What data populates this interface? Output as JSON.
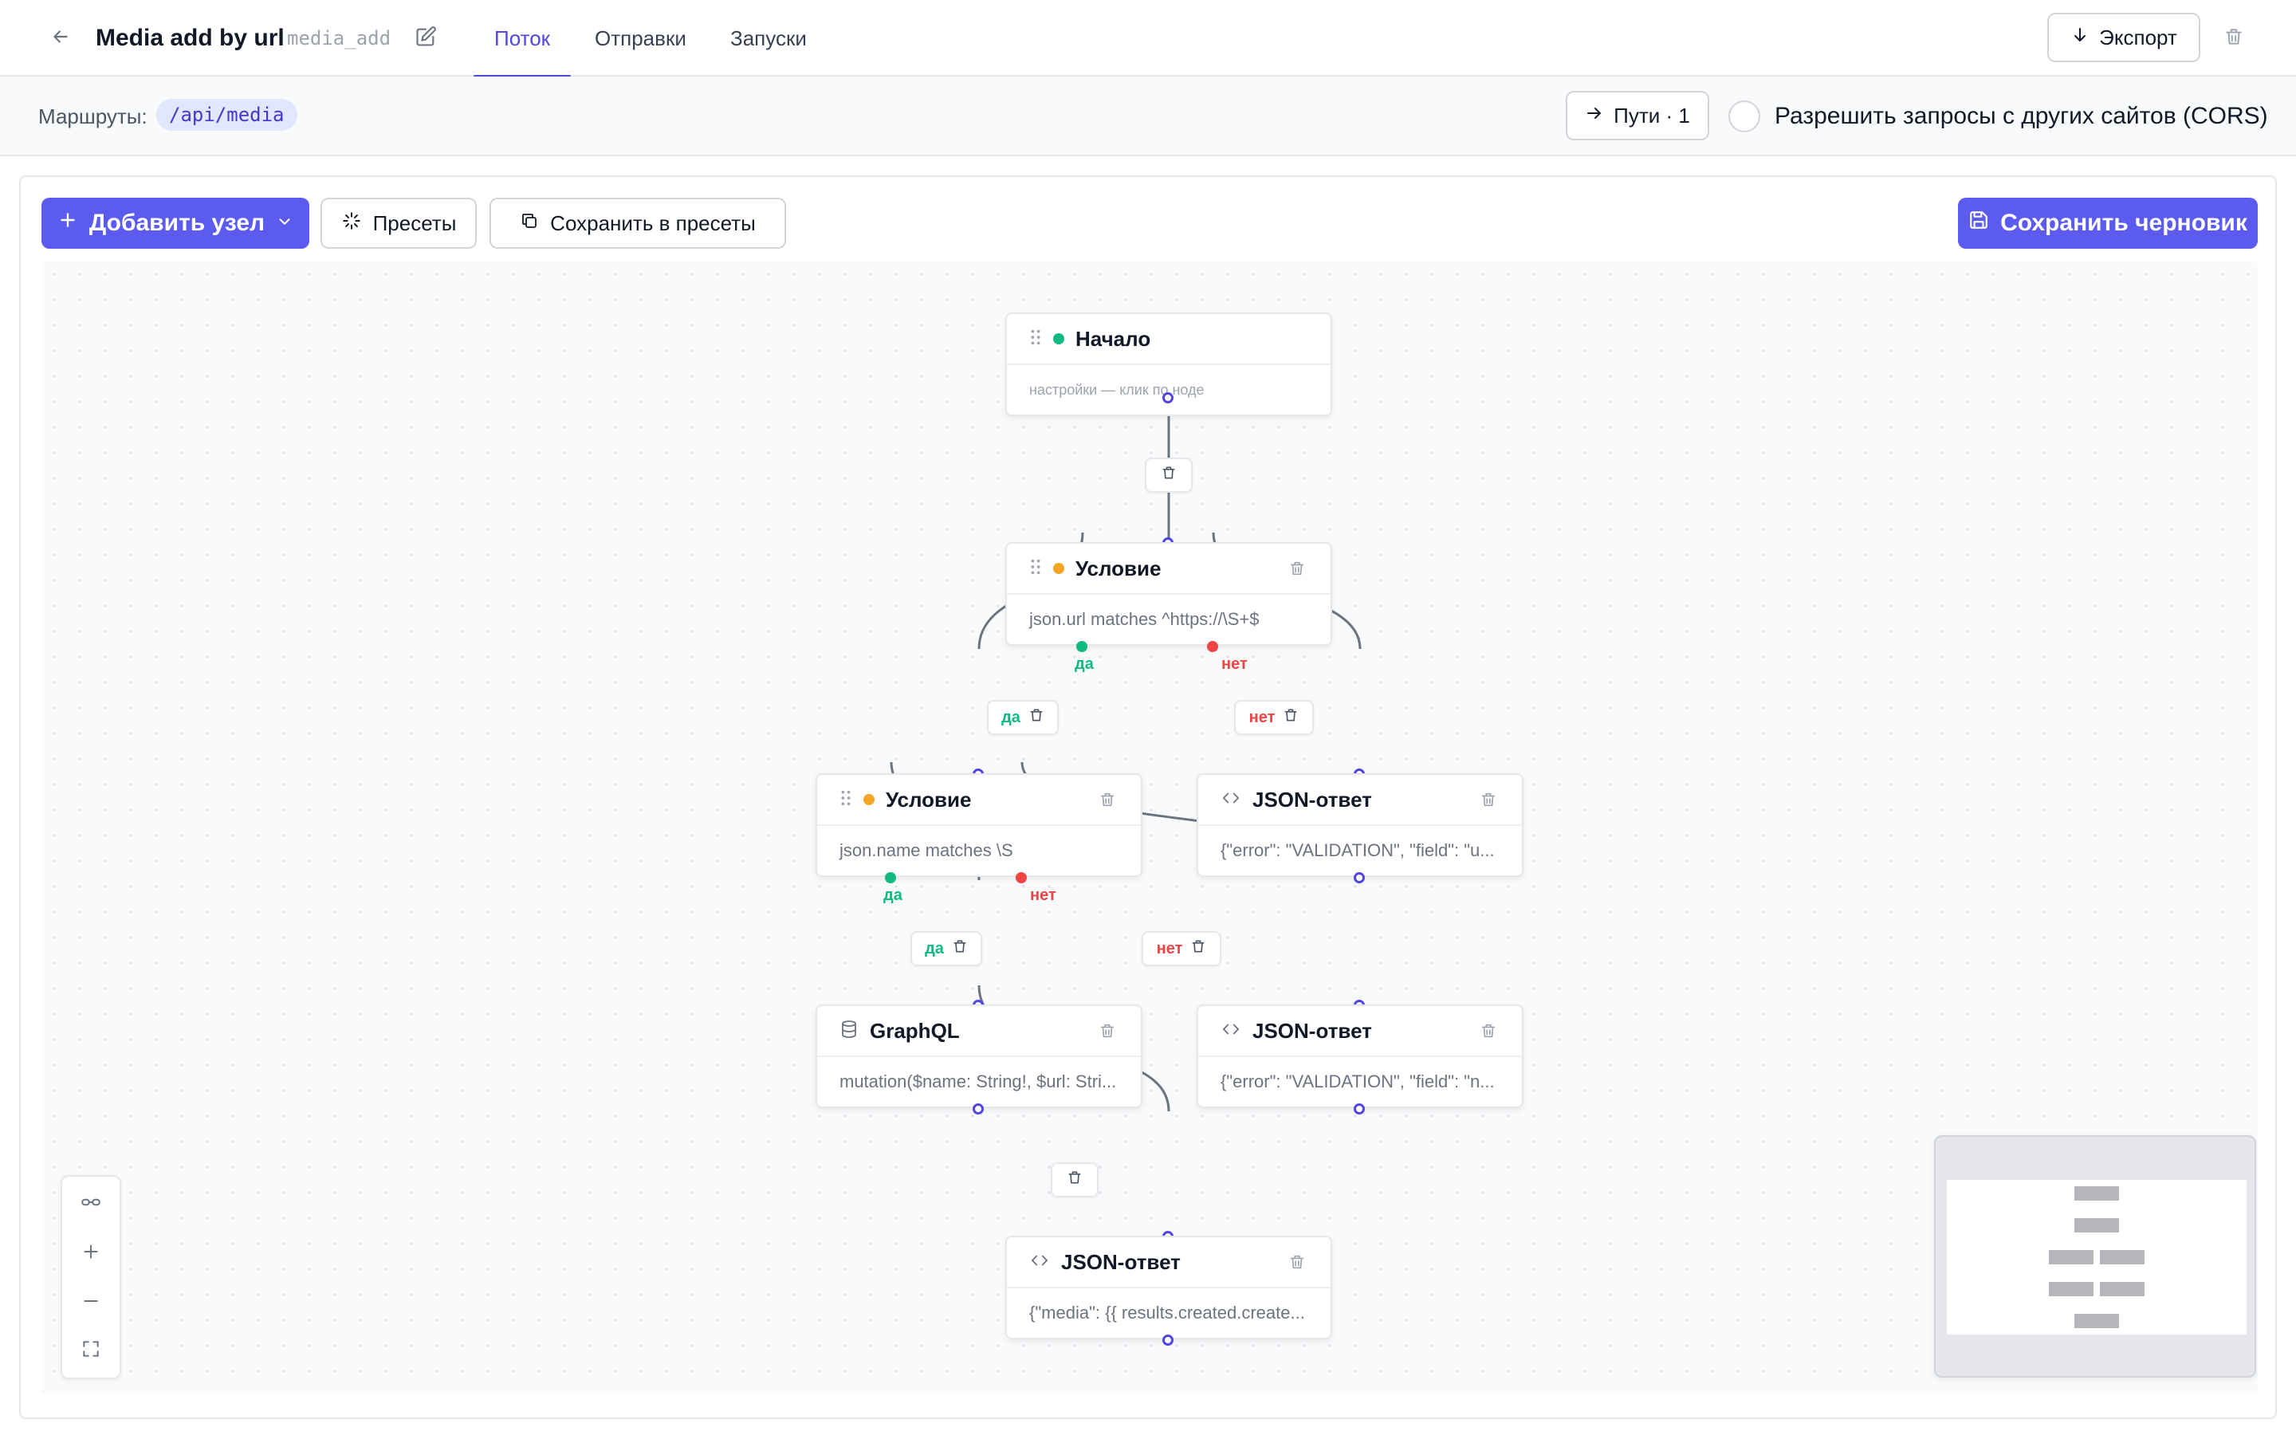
{
  "header": {
    "back_icon": "arrow-left-icon",
    "title": "Media add by url",
    "slug": "media_add",
    "edit_icon": "pencil-square-icon",
    "tabs": [
      {
        "label": "Поток",
        "active": true
      },
      {
        "label": "Отправки",
        "active": false
      },
      {
        "label": "Запуски",
        "active": false
      }
    ],
    "export_label": "Экспорт",
    "export_icon": "arrow-down-icon",
    "delete_icon": "trash-icon"
  },
  "routes": {
    "label": "Маршруты:",
    "route": "/api/media",
    "paths_label": "Пути · 1",
    "cors_label": "Разрешить запросы с других сайтов (CORS)",
    "cors_enabled": false
  },
  "toolbar": {
    "add_node_label": "Добавить узел",
    "presets_label": "Пресеты",
    "save_preset_label": "Сохранить в пресеты",
    "save_draft_label": "Сохранить черновик"
  },
  "colors": {
    "accent": "#5b5bf0",
    "yes": "#10b981",
    "no": "#ef4444",
    "condition_dot": "#f5a524",
    "start_dot": "#10b981"
  },
  "nodes": {
    "start": {
      "title": "Начало",
      "body": "настройки — клик по ноде"
    },
    "cond1": {
      "title": "Условие",
      "body": "json.url matches ^https://\\S+$",
      "yes": "да",
      "no": "нет"
    },
    "cond2": {
      "title": "Условие",
      "body": "json.name matches \\S",
      "yes": "да",
      "no": "нет"
    },
    "json1": {
      "title": "JSON-ответ",
      "body": "{\"error\": \"VALIDATION\", \"field\": \"u..."
    },
    "json2": {
      "title": "JSON-ответ",
      "body": "{\"error\": \"VALIDATION\", \"field\": \"n..."
    },
    "graphql": {
      "title": "GraphQL",
      "body": "mutation($name: String!, $url: Stri..."
    },
    "json3": {
      "title": "JSON-ответ",
      "body": "{\"media\": {{ results.created.create..."
    }
  },
  "edge_labels": {
    "yes": "да",
    "no": "нет"
  }
}
